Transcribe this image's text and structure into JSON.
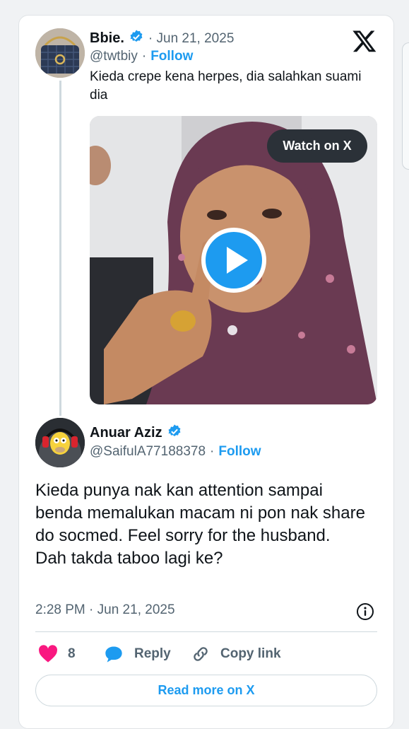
{
  "tweet": {
    "author_name": "Bbie.",
    "date": "· Jun 21, 2025",
    "handle": "@twtbiy",
    "follow_sep": "·",
    "follow_label": "Follow",
    "text": "Kieda crepe kena herpes, dia salahkan suami dia",
    "watch_label": "Watch on X"
  },
  "reply": {
    "author_name": "Anuar Aziz",
    "handle": "@SaifulA77188378",
    "follow_sep": "·",
    "follow_label": "Follow",
    "text": "Kieda punya nak kan attention sampai benda memalukan macam ni pon nak share do socmed. Feel sorry for the husband.\nDah takda taboo lagi ke?",
    "timestamp": "2:28 PM · Jun 21, 2025"
  },
  "actions": {
    "like_count": "8",
    "reply_label": "Reply",
    "copy_label": "Copy link",
    "read_more_label": "Read more on X"
  },
  "colors": {
    "accent": "#1d9bf0",
    "like": "#f91880",
    "text": "#0f1419",
    "muted": "#536471"
  },
  "icons": [
    "verified-badge-icon",
    "x-logo-icon",
    "play-icon",
    "info-icon",
    "heart-icon",
    "reply-bubble-icon",
    "link-icon"
  ]
}
